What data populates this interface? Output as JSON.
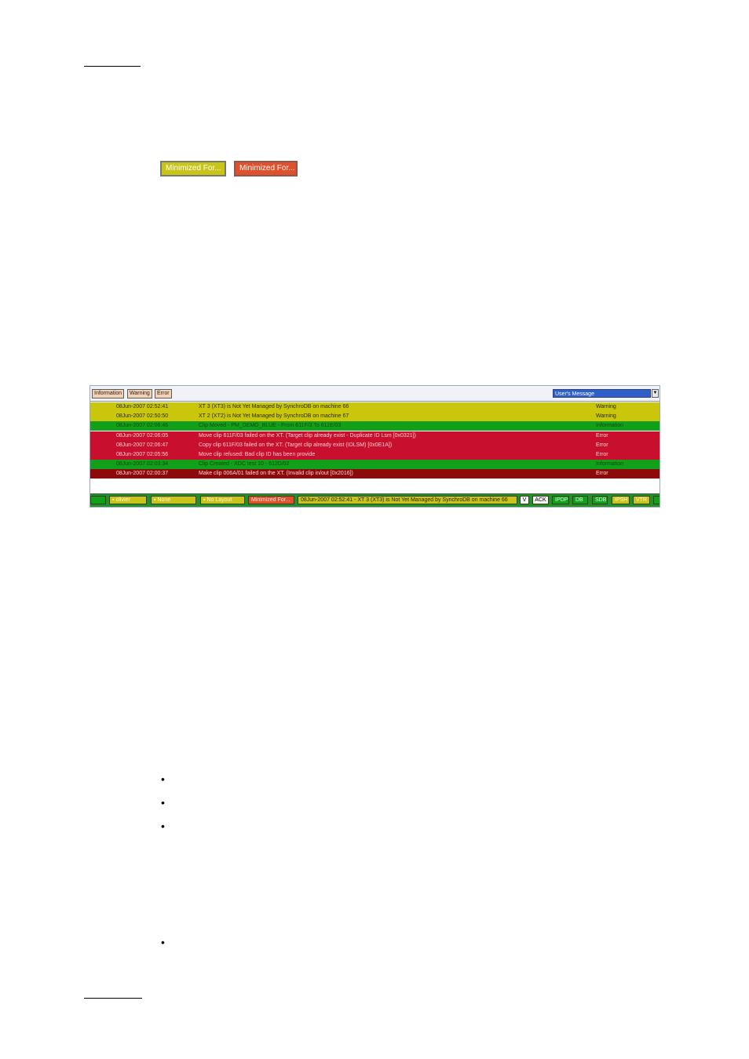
{
  "buttons": {
    "minimized_yellow": "Minimized For...",
    "minimized_red": "Minimized For..."
  },
  "message_panel": {
    "filters": [
      "Information",
      "Warning",
      "Error"
    ],
    "dropdown_value": "User's Message",
    "rows": [
      {
        "time": "08Jun-2007 02:52:41",
        "message": "XT 3 (XT3) is Not Yet Managed by SynchroDB on machine 66",
        "severity": "Warning",
        "level": "warning"
      },
      {
        "time": "08Jun-2007 02:50:50",
        "message": "XT 2 (XT2) is Not Yet Managed by SynchroDB on machine 67",
        "severity": "Warning",
        "level": "warning"
      },
      {
        "time": "08Jun-2007 02:06:46",
        "message": "Clip Moved - PM_DEMO_BLUE - From 611F/3 To 611E/03",
        "severity": "Information",
        "level": "info"
      },
      {
        "time": "08Jun-2007 02:06:05",
        "message": "Move clip 611F/03 failed on the XT. (Target clip already exist - Duplicate ID Lsm [0x0321])",
        "severity": "Error",
        "level": "error"
      },
      {
        "time": "08Jun-2007 02:06:47",
        "message": "Copy clip 611F/03 failed on the XT. (Target clip already exist (IDLSM) [0x0E1A])",
        "severity": "Error",
        "level": "error"
      },
      {
        "time": "08Jun-2007 02:05:56",
        "message": "Move clip refused: Bad clip ID has been provide",
        "severity": "Error",
        "level": "error"
      },
      {
        "time": "08Jun-2007 02:03:34",
        "message": "Clip Created - XDC test 10 - 612D/02",
        "severity": "Information",
        "level": "info"
      },
      {
        "time": "08Jun-2007 02:00:37",
        "message": "Make clip 006A/01 failed on the XT. (Invalid clip in/out [0x2016])",
        "severity": "Error",
        "level": "critical"
      }
    ],
    "taskbar": {
      "user": "olivier",
      "selection": "None",
      "layout": "No Layout",
      "minimized": "Minimized For...",
      "ticker": "08Jun-2007 02:52:41 - XT 3 (XT3) is Not Yet Managed by SynchroDB on machine 66",
      "v_button": "V",
      "ack_button": "ACK",
      "status_pills": [
        "IPDP",
        "DB",
        "SDB",
        "IPSH",
        "VTR"
      ]
    }
  },
  "bullets": [
    "•",
    "•",
    "•",
    "•"
  ],
  "colors": {
    "warning": "#c9c60c",
    "information": "#12a01a",
    "error": "#c8102e",
    "critical": "#8c0a0a",
    "minimized_red": "#e0502a"
  }
}
